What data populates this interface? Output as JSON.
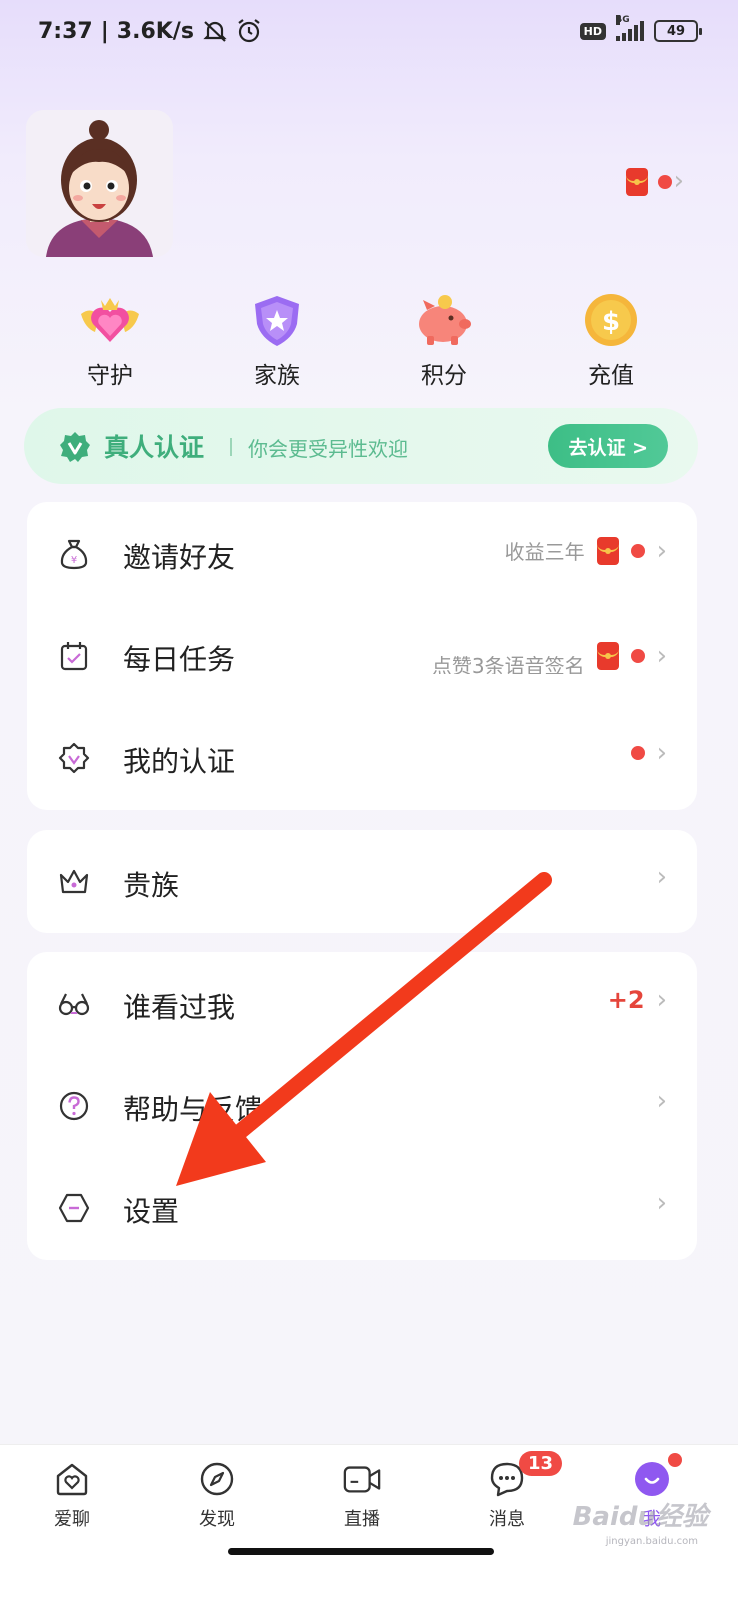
{
  "status_bar": {
    "time": "7:37",
    "speed": "3.6K/s",
    "network": "4G",
    "hd": "HD",
    "battery": "49"
  },
  "quick_actions": [
    {
      "label": "守护",
      "icon": "guardian-heart-icon"
    },
    {
      "label": "家族",
      "icon": "family-shield-icon"
    },
    {
      "label": "积分",
      "icon": "piggy-bank-icon"
    },
    {
      "label": "充值",
      "icon": "coin-icon"
    }
  ],
  "verify_banner": {
    "title": "真人认证",
    "subtitle": "你会更受异性欢迎",
    "button": "去认证 >"
  },
  "menu_card_1": [
    {
      "label": "邀请好友",
      "hint": "收益三年",
      "icon": "money-bag-icon"
    },
    {
      "label": "每日任务",
      "hint": "点赞3条语音签名",
      "icon": "calendar-check-icon"
    },
    {
      "label": "我的认证",
      "hint": "",
      "icon": "badge-check-icon"
    }
  ],
  "menu_card_2": [
    {
      "label": "贵族",
      "icon": "crown-icon"
    }
  ],
  "menu_card_3": [
    {
      "label": "谁看过我",
      "count": "+2",
      "icon": "glasses-icon"
    },
    {
      "label": "帮助与反馈",
      "icon": "question-circle-icon"
    },
    {
      "label": "设置",
      "icon": "settings-hexagon-icon"
    }
  ],
  "tabbar": {
    "items": [
      {
        "label": "爱聊",
        "icon": "home-heart-icon"
      },
      {
        "label": "发现",
        "icon": "compass-icon"
      },
      {
        "label": "直播",
        "icon": "video-camera-icon"
      },
      {
        "label": "消息",
        "icon": "chat-bubble-icon",
        "badge": "13"
      },
      {
        "label": "我",
        "icon": "me-smile-icon"
      }
    ]
  },
  "watermark": {
    "text": "Baidu经验",
    "url": "jingyan.baidu.com"
  },
  "colors": {
    "green": "#3fae7c",
    "red": "#f04a44",
    "purple": "#8f58f0"
  }
}
